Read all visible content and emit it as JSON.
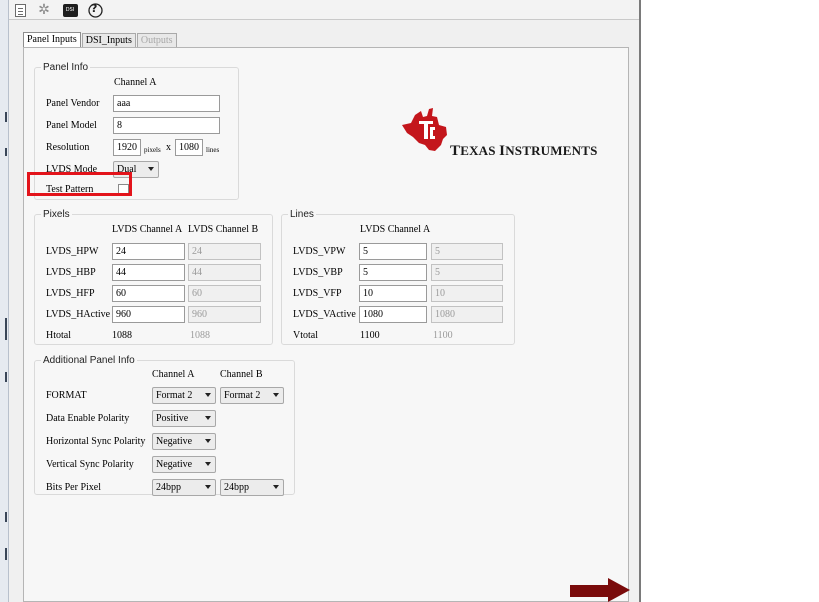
{
  "toolbar": {
    "icons": [
      "document-icon",
      "gear-icon",
      "dsi-chip-icon",
      "help-icon"
    ],
    "dsi_chip_text": "DSI",
    "help_glyph": "?",
    "gear_glyph": "✲"
  },
  "tabs": [
    {
      "label": "Panel Inputs",
      "active": true
    },
    {
      "label": "DSI_Inputs",
      "active": false
    },
    {
      "label": "Outputs",
      "active": false,
      "disabled": true
    }
  ],
  "panel_info": {
    "title": "Panel Info",
    "column_header": "Channel A",
    "vendor_label": "Panel Vendor",
    "vendor_value": "aaa",
    "model_label": "Panel Model",
    "model_value": "8",
    "resolution_label": "Resolution",
    "res_width": "1920",
    "pixels_unit": "pixels",
    "x_sep": "x",
    "res_height": "1080",
    "lines_unit": "lines",
    "lvds_mode_label": "LVDS Mode",
    "lvds_mode_value": "Dual",
    "test_pattern_label": "Test Pattern",
    "test_pattern_checked": false
  },
  "logo": {
    "text": "Texas Instruments",
    "color": "#c4161c"
  },
  "pixels": {
    "title": "Pixels",
    "col_a": "LVDS Channel A",
    "col_b": "LVDS Channel B",
    "rows": [
      {
        "label": "LVDS_HPW",
        "a": "24",
        "b": "24"
      },
      {
        "label": "LVDS_HBP",
        "a": "44",
        "b": "44"
      },
      {
        "label": "LVDS_HFP",
        "a": "60",
        "b": "60"
      },
      {
        "label": "LVDS_HActive",
        "a": "960",
        "b": "960"
      }
    ],
    "total_label": "Htotal",
    "total_a": "1088",
    "total_b": "1088"
  },
  "lines": {
    "title": "Lines",
    "col_a": "LVDS Channel A",
    "rows": [
      {
        "label": "LVDS_VPW",
        "a": "5",
        "b": "5"
      },
      {
        "label": "LVDS_VBP",
        "a": "5",
        "b": "5"
      },
      {
        "label": "LVDS_VFP",
        "a": "10",
        "b": "10"
      },
      {
        "label": "LVDS_VActive",
        "a": "1080",
        "b": "1080"
      }
    ],
    "total_label": "Vtotal",
    "total_a": "1100",
    "total_b": "1100"
  },
  "additional": {
    "title": "Additional Panel Info",
    "col_a": "Channel A",
    "col_b": "Channel B",
    "rows": [
      {
        "label": "FORMAT",
        "a": "Format 2",
        "b": "Format 2"
      },
      {
        "label": "Data Enable Polarity",
        "a": "Positive"
      },
      {
        "label": "Horizontal Sync Polarity",
        "a": "Negative"
      },
      {
        "label": "Vertical Sync Polarity",
        "a": "Negative"
      },
      {
        "label": "Bits Per Pixel",
        "a": "24bpp",
        "b": "24bpp"
      }
    ]
  },
  "colors": {
    "highlight": "#e3141b",
    "next_arrow": "#7a0b0b"
  }
}
